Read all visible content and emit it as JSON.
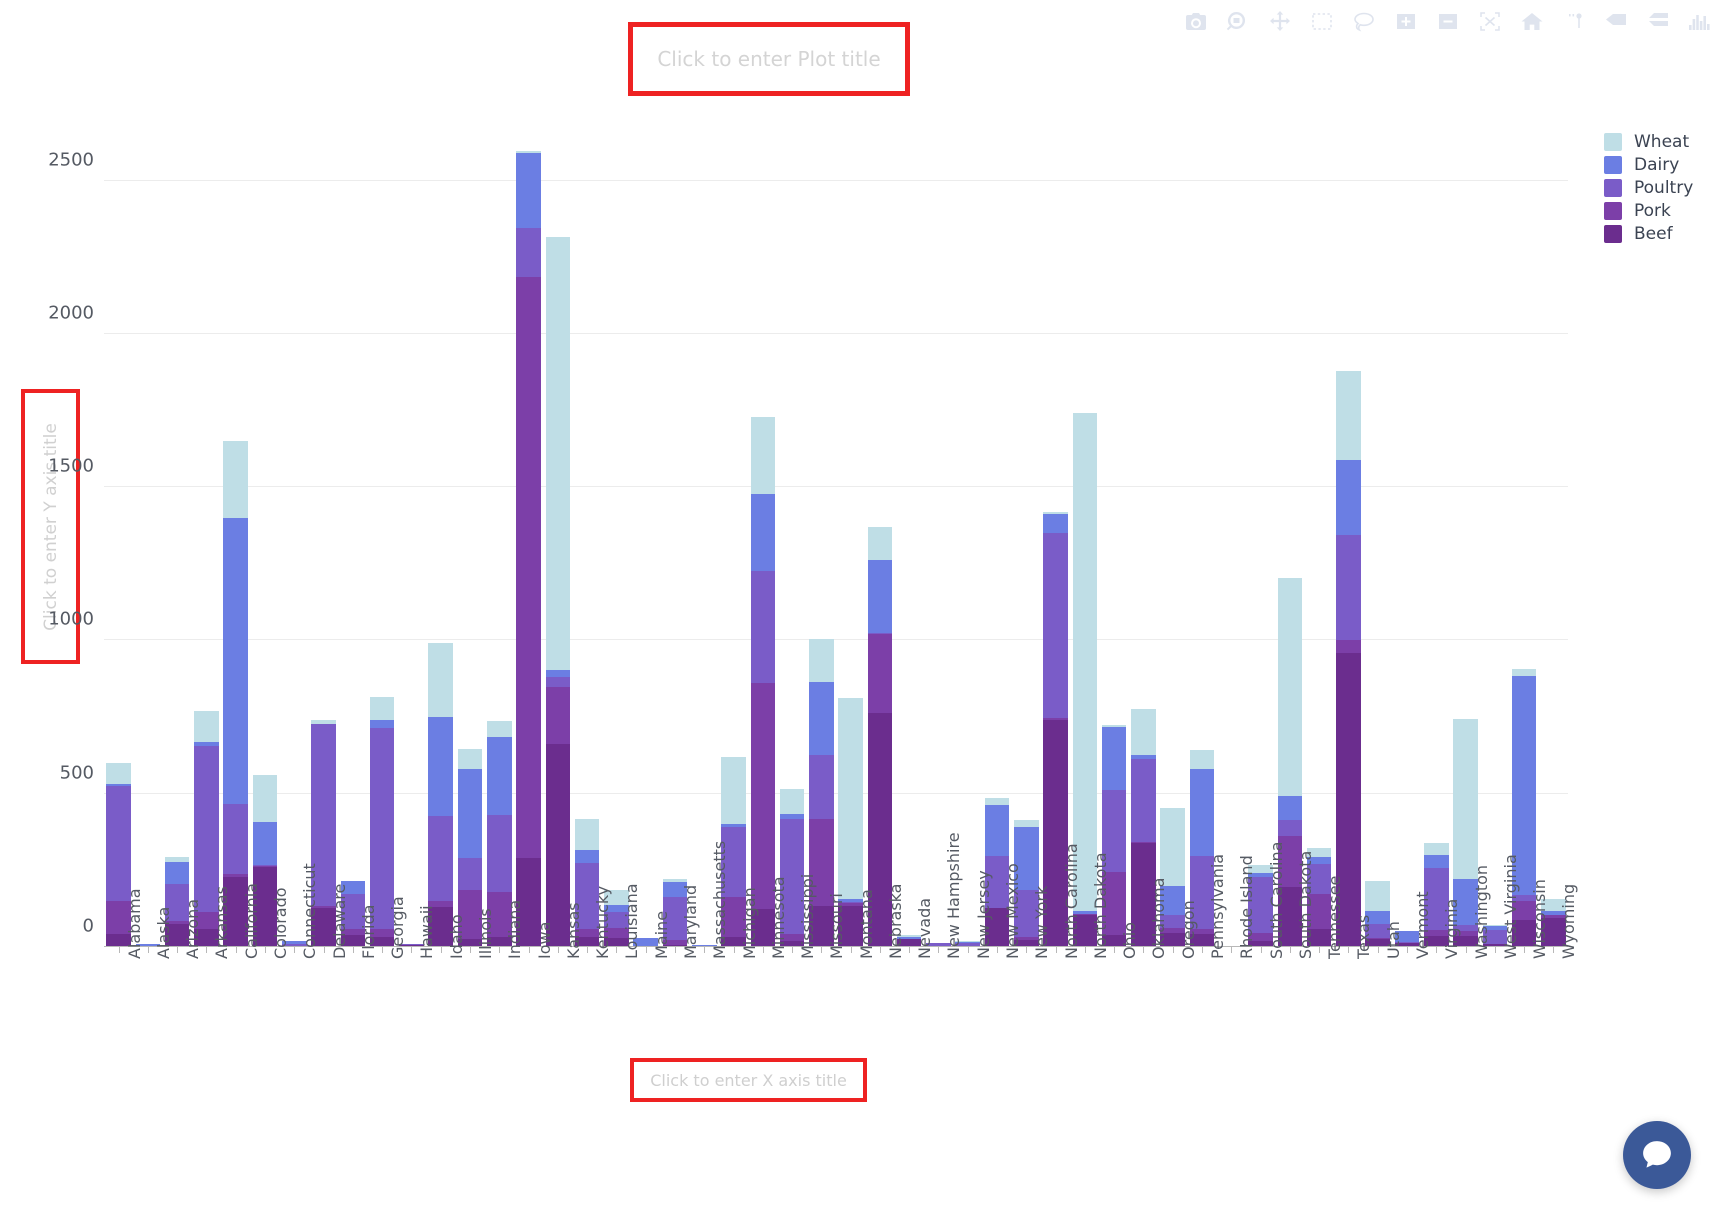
{
  "title": {
    "placeholder": "Click to enter Plot title",
    "highlight_color": "#ee2222"
  },
  "yaxis": {
    "title_placeholder": "Click to enter Y axis title",
    "ticks": [
      0,
      500,
      1000,
      1500,
      2000,
      2500
    ],
    "range": [
      0,
      2600
    ]
  },
  "xaxis": {
    "title_placeholder": "Click to enter X axis title"
  },
  "modebar": {
    "buttons": [
      {
        "name": "download-plot-as-png-icon",
        "title": "Download plot as a png"
      },
      {
        "name": "zoom-icon",
        "title": "Zoom"
      },
      {
        "name": "pan-icon",
        "title": "Pan"
      },
      {
        "name": "box-select-icon",
        "title": "Box Select"
      },
      {
        "name": "lasso-select-icon",
        "title": "Lasso Select"
      },
      {
        "name": "zoom-in-icon",
        "title": "Zoom in"
      },
      {
        "name": "zoom-out-icon",
        "title": "Zoom out"
      },
      {
        "name": "autoscale-icon",
        "title": "Autoscale"
      },
      {
        "name": "reset-axes-icon",
        "title": "Reset axes"
      },
      {
        "name": "toggle-spike-lines-icon",
        "title": "Toggle Spike Lines"
      },
      {
        "name": "hover-compare-icon",
        "title": "Show closest data on hover"
      },
      {
        "name": "hover-closest-icon",
        "title": "Compare data on hover"
      },
      {
        "name": "plotly-logo-icon",
        "title": "Produced with Plotly"
      }
    ]
  },
  "legend": {
    "items": [
      {
        "label": "Wheat",
        "color": "#bfdee6"
      },
      {
        "label": "Dairy",
        "color": "#6b7ee3"
      },
      {
        "label": "Poultry",
        "color": "#7a5cc8"
      },
      {
        "label": "Pork",
        "color": "#7c3fa8"
      },
      {
        "label": "Beef",
        "color": "#6b2d8e"
      }
    ]
  },
  "chat": {
    "icon": "chat-bubble-icon"
  },
  "chart_data": {
    "type": "bar",
    "barmode": "stack",
    "title": "",
    "xlabel": "",
    "ylabel": "",
    "ylim": [
      0,
      2600
    ],
    "grid": true,
    "legend_position": "right",
    "categories": [
      "Alabama",
      "Alaska",
      "Arizona",
      "Arkansas",
      "California",
      "Colorado",
      "Connecticut",
      "Delaware",
      "Florida",
      "Georgia",
      "Hawaii",
      "Idaho",
      "Illinois",
      "Indiana",
      "Iowa",
      "Kansas",
      "Kentucky",
      "Louisiana",
      "Maine",
      "Maryland",
      "Massachusetts",
      "Michigan",
      "Minnesota",
      "Mississippi",
      "Missouri",
      "Montana",
      "Nebraska",
      "Nevada",
      "New Hampshire",
      "New Jersey",
      "New Mexico",
      "New York",
      "North Carolina",
      "North Dakota",
      "Ohio",
      "Oklahoma",
      "Oregon",
      "Pennsylvania",
      "Rhode Island",
      "South Carolina",
      "South Dakota",
      "Tennessee",
      "Texas",
      "Utah",
      "Vermont",
      "Virginia",
      "Washington",
      "West Virginia",
      "Wisconsin",
      "Wyoming"
    ],
    "series": [
      {
        "name": "Beef",
        "color": "#6b2d8e",
        "values": [
          43,
          2,
          75,
          58,
          228,
          261,
          3,
          126,
          40,
          33,
          5,
          130,
          27,
          34,
          291,
          661,
          33,
          30,
          0,
          7,
          1,
          34,
          125,
          21,
          133,
          135,
          763,
          25,
          1,
          2,
          126,
          22,
          741,
          105,
          39,
          338,
          45,
          42,
          0,
          20,
          195,
          58,
          960,
          26,
          12,
          37,
          35,
          9,
          89,
          95
        ]
      },
      {
        "name": "Pork",
        "color": "#7c3fa8",
        "values": [
          107,
          0,
          9,
          55,
          11,
          4,
          0,
          9,
          18,
          27,
          2,
          21,
          160,
          145,
          1894,
          188,
          26,
          31,
          1,
          16,
          0,
          129,
          736,
          23,
          284,
          9,
          258,
          2,
          1,
          2,
          0,
          11,
          5,
          0.9,
          207,
          4,
          17,
          17,
          0,
          26,
          167,
          114,
          40,
          5,
          0,
          18,
          17,
          2,
          61,
          9
        ]
      },
      {
        "name": "Poultry",
        "color": "#7a5cc8",
        "values": [
          374,
          1,
          121,
          542,
          229,
          2,
          6,
          591,
          115,
          653,
          1,
          277,
          105,
          252,
          162,
          32,
          214,
          54,
          3,
          139,
          1,
          229,
          367,
          375,
          211,
          1,
          4,
          0,
          8,
          9,
          172,
          154,
          604,
          0,
          265,
          272,
          42,
          237,
          0,
          184,
          52,
          98,
          345,
          43,
          3,
          204,
          20,
          46,
          20,
          1
        ]
      },
      {
        "name": "Dairy",
        "color": "#6b7ee3",
        "values": [
          8,
          5,
          71,
          14,
          932,
          140,
          11,
          2,
          43,
          27,
          1,
          321,
          290,
          255,
          244,
          24,
          44,
          22,
          24,
          50,
          3,
          9,
          249,
          15,
          238,
          12,
          237,
          6,
          2,
          5,
          166,
          206,
          63,
          12,
          208,
          14,
          96,
          286,
          2,
          12,
          78,
          25,
          243,
          43,
          36,
          41,
          151,
          13,
          715,
          10
        ]
      },
      {
        "name": "Wheat",
        "color": "#bfdee6",
        "values": [
          70,
          0,
          19,
          102,
          250,
          155,
          0,
          14,
          0,
          77,
          0,
          244,
          64,
          53,
          6,
          1412,
          101,
          49,
          0,
          11,
          0,
          219,
          251,
          81,
          138,
          655,
          109,
          5,
          0,
          1,
          22,
          20,
          7,
          1624,
          5,
          147,
          255,
          61,
          0,
          27,
          711,
          28,
          290,
          100,
          0,
          41,
          520,
          3,
          23,
          40
        ]
      }
    ]
  }
}
